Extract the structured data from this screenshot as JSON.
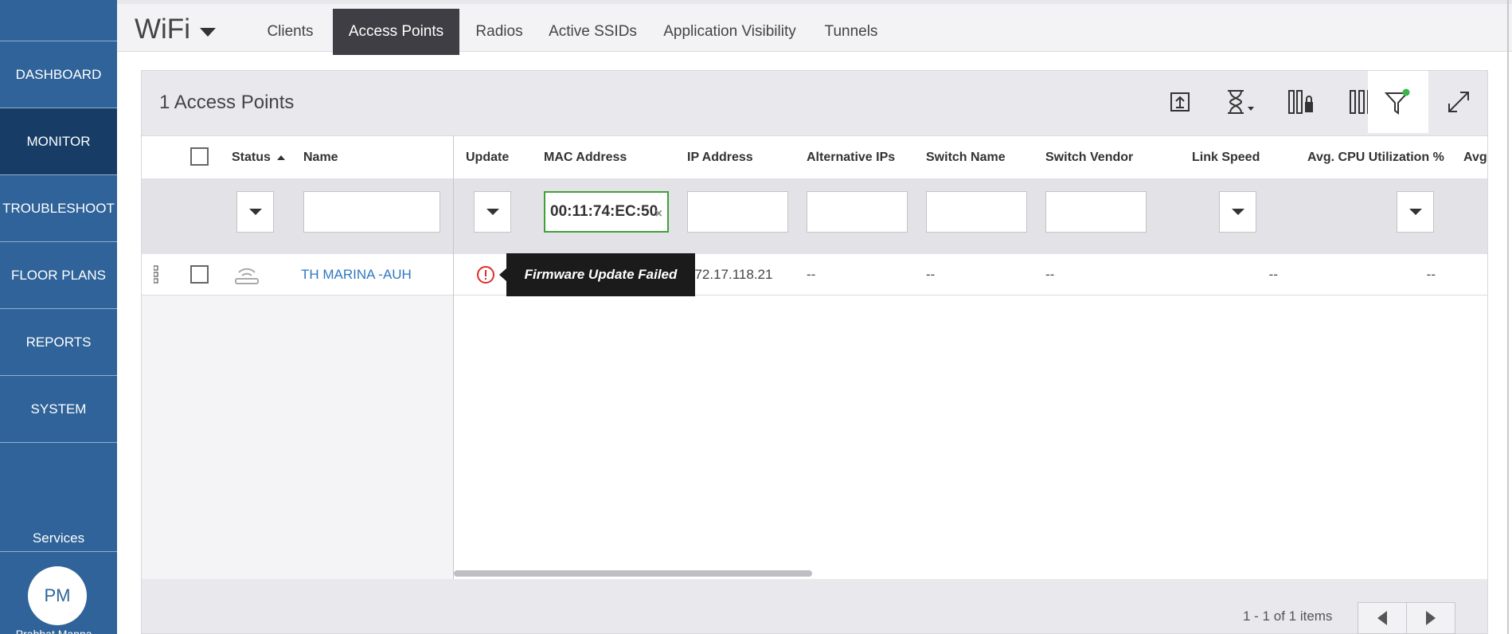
{
  "sidebar": {
    "items": [
      {
        "label": "DASHBOARD"
      },
      {
        "label": "MONITOR"
      },
      {
        "label": "TROUBLESHOOT"
      },
      {
        "label": "FLOOR PLANS"
      },
      {
        "label": "REPORTS"
      },
      {
        "label": "SYSTEM"
      }
    ],
    "services_label": "Services",
    "avatar_initials": "PM",
    "avatar_name": "Prabhat Manna..."
  },
  "header": {
    "title": "WiFi",
    "tabs": [
      {
        "label": "Clients"
      },
      {
        "label": "Access Points"
      },
      {
        "label": "Radios"
      },
      {
        "label": "Active SSIDs"
      },
      {
        "label": "Application Visibility"
      },
      {
        "label": "Tunnels"
      }
    ]
  },
  "panel": {
    "title": "1 Access Points"
  },
  "toolbar": {
    "icons": [
      "export-icon",
      "time-range-icon",
      "lock-columns-icon",
      "columns-icon",
      "filter-icon",
      "expand-icon"
    ],
    "filter_active_color": "#39b54a"
  },
  "grid": {
    "columns": [
      {
        "label": "Status"
      },
      {
        "label": "Name"
      },
      {
        "label": "Update"
      },
      {
        "label": "MAC Address"
      },
      {
        "label": "IP Address"
      },
      {
        "label": "Alternative IPs"
      },
      {
        "label": "Switch Name"
      },
      {
        "label": "Switch Vendor"
      },
      {
        "label": "Link Speed"
      },
      {
        "label": "Avg. CPU Utilization %"
      },
      {
        "label": "Avg."
      }
    ],
    "filters": {
      "mac_address": "00:11:74:EC:50",
      "name": "",
      "ip_address": "",
      "alternative_ips": "",
      "switch_name": "",
      "switch_vendor": ""
    },
    "rows": [
      {
        "name": "TH MARINA -AUH",
        "ip_address": "172.17.118.21",
        "alternative_ips": "--",
        "switch_name": "--",
        "switch_vendor": "--",
        "link_speed": "--",
        "avg_cpu": "--"
      }
    ],
    "tooltip": "Firmware Update Failed",
    "alert_color": "#e02b2b"
  },
  "pager": {
    "info": "1 - 1 of 1 items"
  }
}
